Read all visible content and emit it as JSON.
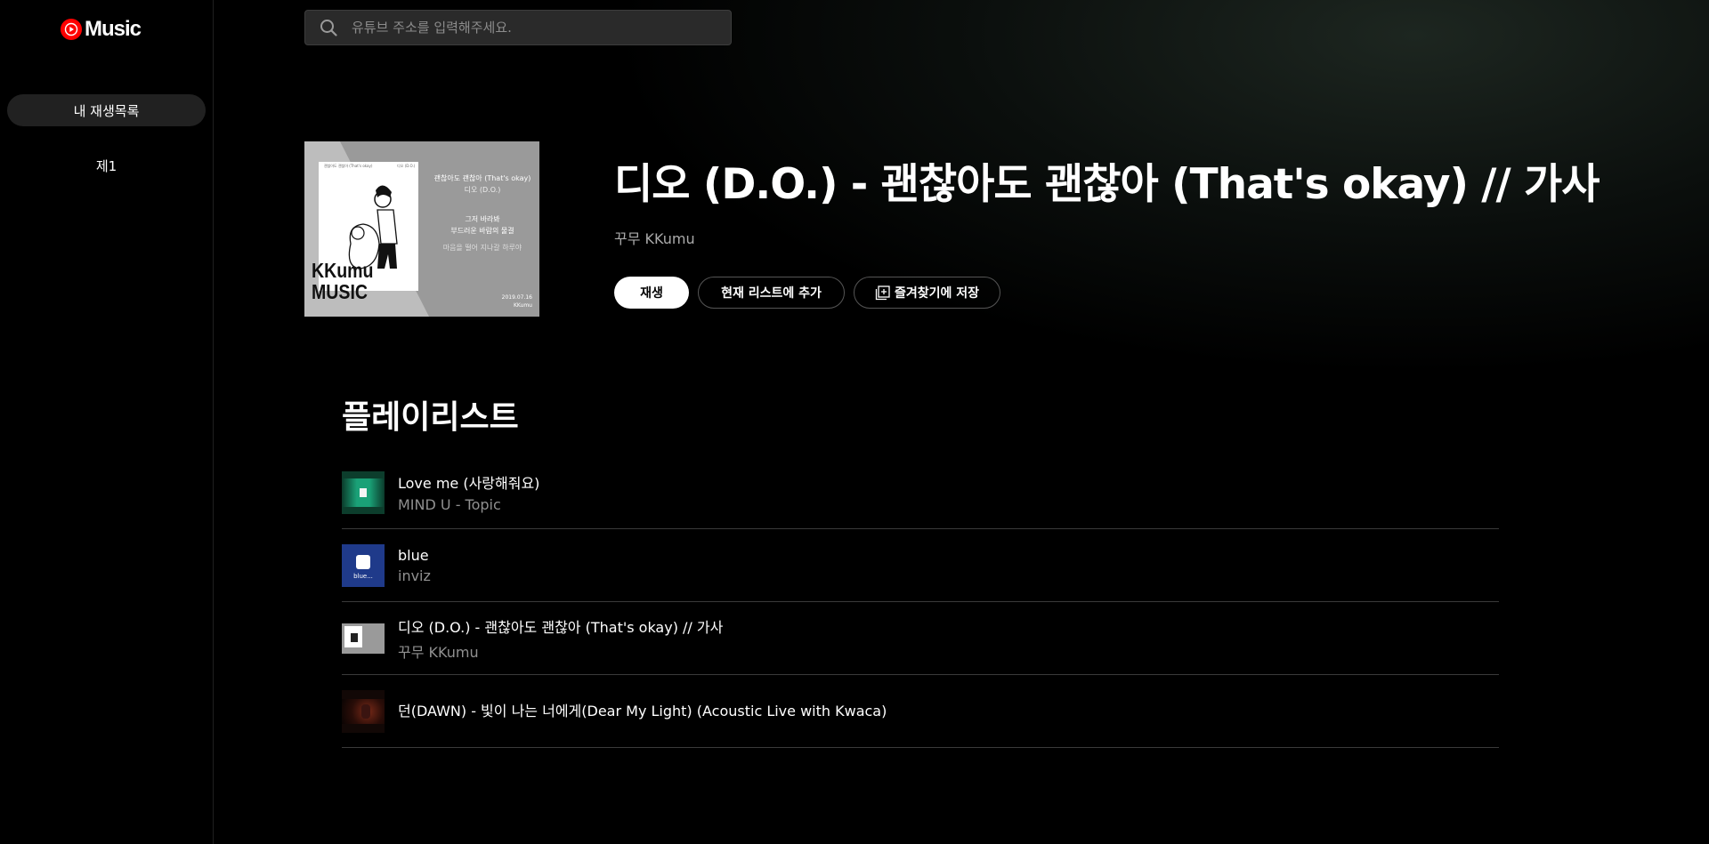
{
  "app": {
    "logo_text": "Music"
  },
  "sidebar": {
    "items": [
      {
        "label": "내 재생목록",
        "active": true
      },
      {
        "label": "제1",
        "active": false
      }
    ]
  },
  "search": {
    "placeholder": "유튜브 주소를 입력해주세요.",
    "value": ""
  },
  "song": {
    "title": "디오 (D.O.) - 괜찮아도 괜찮아 (That's okay) // 가사",
    "artist": "꾸무 KKumu",
    "cover": {
      "header": "괜찮아도 괜찮아 (That's okay)",
      "subheader": "디오 (D.O.)",
      "lyric_1": "그저 바라봐",
      "lyric_2": "부드러운 바람의 물결",
      "lyric_3": "마음을 떨어 지나갈 하루야",
      "brand_1": "KKumu",
      "brand_2": "MUSIC",
      "date": "2019.07.16",
      "credit": "KKumu",
      "paper_caption_left": "괜찮아도 괜찮아 (That's okay)",
      "paper_caption_right": "디오 (D.O.)"
    }
  },
  "actions": {
    "play_label": "재생",
    "add_to_list_label": "현재 리스트에 추가",
    "save_label": "즐겨찾기에 저장"
  },
  "playlist": {
    "heading": "플레이리스트",
    "items": [
      {
        "title": "Love me (사랑해줘요)",
        "subtitle": "MIND U - Topic"
      },
      {
        "title": "blue",
        "subtitle": "inviz",
        "thumb_text": "blue..."
      },
      {
        "title": "디오 (D.O.) - 괜찮아도 괜찮아 (That's okay) // 가사",
        "subtitle": "꾸무 KKumu"
      },
      {
        "title": "던(DAWN) - 빛이 나는 너에게(Dear My Light) (Acoustic Live with Kwaca)",
        "subtitle": ""
      }
    ]
  },
  "colors": {
    "brand_red": "#ff0000",
    "background": "#000000",
    "active_nav": "#212121"
  }
}
